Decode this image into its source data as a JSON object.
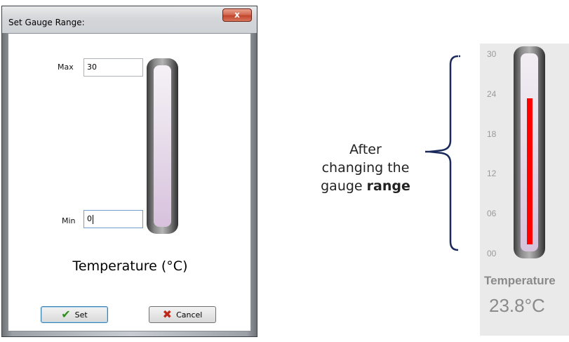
{
  "dialog": {
    "title": "Set Gauge Range:",
    "close_glyph": "x",
    "max_label": "Max",
    "max_value": "30",
    "min_label": "Min",
    "min_value": "0",
    "caption": "Temperature (°C)",
    "set_label": "Set",
    "cancel_label": "Cancel",
    "icons": {
      "set": "checkmark-icon",
      "cancel": "cross-icon"
    }
  },
  "annotation": {
    "line1": "After",
    "line2": "changing the",
    "line3_prefix": "gauge",
    "line3_bold": "range"
  },
  "gauge_panel": {
    "ticks": [
      "30",
      "24",
      "18",
      "12",
      "06",
      "00"
    ],
    "range": {
      "min": 0,
      "max": 30
    },
    "value": 23.8,
    "name": "Temperature",
    "value_label": "23.8°C",
    "fill_color": "#ff0000"
  }
}
